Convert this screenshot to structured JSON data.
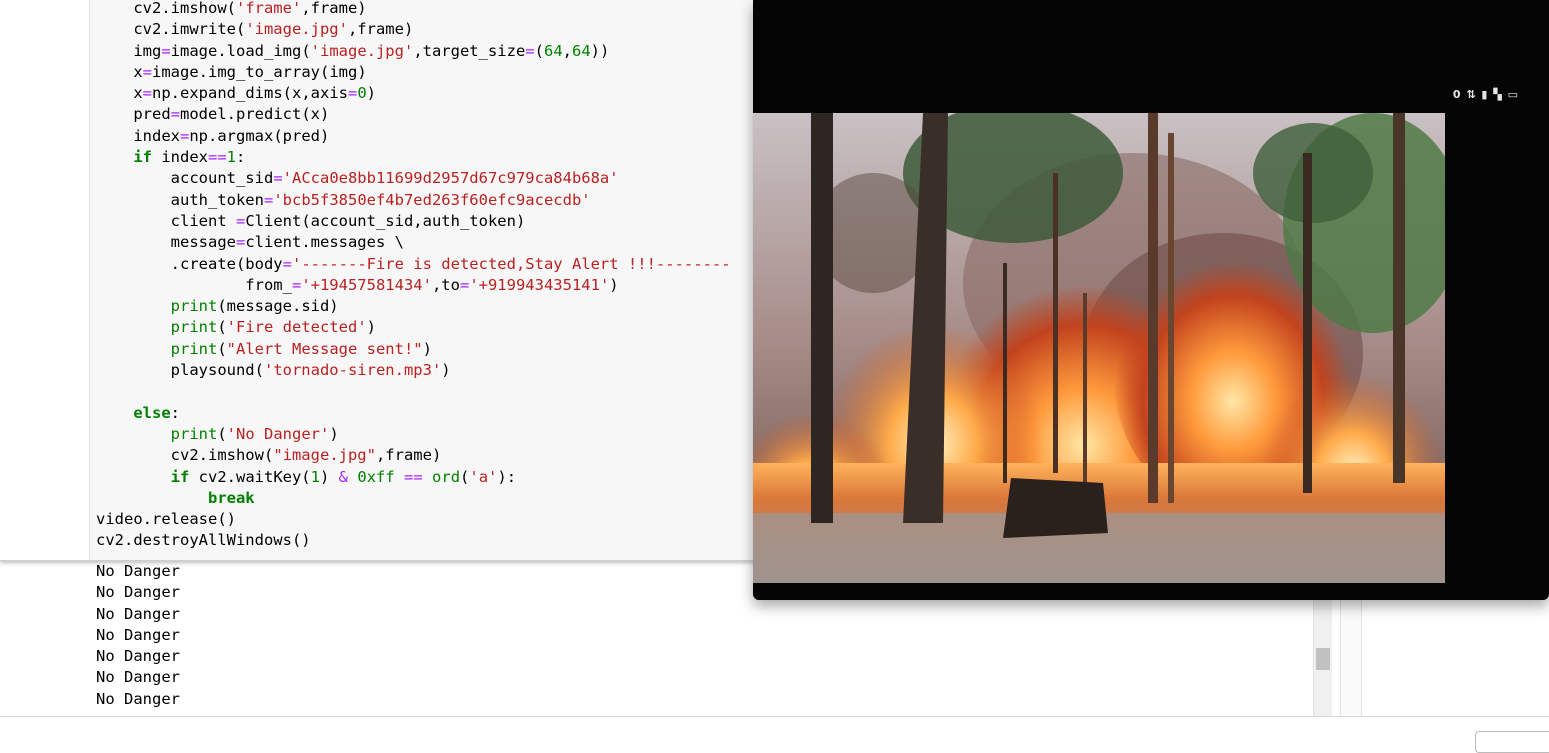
{
  "code_lines": [
    [
      {
        "t": "    cv2.imshow("
      },
      {
        "t": "'frame'",
        "c": "str"
      },
      {
        "t": ",frame)"
      }
    ],
    [
      {
        "t": "    cv2.imwrite("
      },
      {
        "t": "'image.jpg'",
        "c": "str"
      },
      {
        "t": ",frame)"
      }
    ],
    [
      {
        "t": "    img"
      },
      {
        "t": "=",
        "c": "op"
      },
      {
        "t": "image.load_img("
      },
      {
        "t": "'image.jpg'",
        "c": "str"
      },
      {
        "t": ",target_size"
      },
      {
        "t": "=",
        "c": "op"
      },
      {
        "t": "("
      },
      {
        "t": "64",
        "c": "num"
      },
      {
        "t": ","
      },
      {
        "t": "64",
        "c": "num"
      },
      {
        "t": "))"
      }
    ],
    [
      {
        "t": "    x"
      },
      {
        "t": "=",
        "c": "op"
      },
      {
        "t": "image.img_to_array(img)"
      }
    ],
    [
      {
        "t": "    x"
      },
      {
        "t": "=",
        "c": "op"
      },
      {
        "t": "np.expand_dims(x,axis"
      },
      {
        "t": "=",
        "c": "op"
      },
      {
        "t": "0",
        "c": "num"
      },
      {
        "t": ")"
      }
    ],
    [
      {
        "t": "    pred"
      },
      {
        "t": "=",
        "c": "op"
      },
      {
        "t": "model.predict(x)"
      }
    ],
    [
      {
        "t": "    index"
      },
      {
        "t": "=",
        "c": "op"
      },
      {
        "t": "np.argmax(pred)"
      }
    ],
    [
      {
        "t": "    "
      },
      {
        "t": "if",
        "c": "kw"
      },
      {
        "t": " index"
      },
      {
        "t": "==",
        "c": "op"
      },
      {
        "t": "1",
        "c": "num"
      },
      {
        "t": ":"
      }
    ],
    [
      {
        "t": "        account_sid"
      },
      {
        "t": "=",
        "c": "op"
      },
      {
        "t": "'ACca0e8bb11699d2957d67c979ca84b68a'",
        "c": "str"
      }
    ],
    [
      {
        "t": "        auth_token"
      },
      {
        "t": "=",
        "c": "op"
      },
      {
        "t": "'bcb5f3850ef4b7ed263f60efc9acecdb'",
        "c": "str"
      }
    ],
    [
      {
        "t": "        client "
      },
      {
        "t": "=",
        "c": "op"
      },
      {
        "t": "Client(account_sid,auth_token)"
      }
    ],
    [
      {
        "t": "        message"
      },
      {
        "t": "=",
        "c": "op"
      },
      {
        "t": "client.messages \\"
      }
    ],
    [
      {
        "t": "        .create(body"
      },
      {
        "t": "=",
        "c": "op"
      },
      {
        "t": "'-------Fire is detected,Stay Alert !!!--------",
        "c": "str"
      }
    ],
    [
      {
        "t": "                from_"
      },
      {
        "t": "=",
        "c": "op"
      },
      {
        "t": "'+19457581434'",
        "c": "str"
      },
      {
        "t": ",to"
      },
      {
        "t": "=",
        "c": "op"
      },
      {
        "t": "'+919943435141'",
        "c": "str"
      },
      {
        "t": ")"
      }
    ],
    [
      {
        "t": "        "
      },
      {
        "t": "print",
        "c": "fn"
      },
      {
        "t": "(message.sid)"
      }
    ],
    [
      {
        "t": "        "
      },
      {
        "t": "print",
        "c": "fn"
      },
      {
        "t": "("
      },
      {
        "t": "'Fire detected'",
        "c": "str"
      },
      {
        "t": ")"
      }
    ],
    [
      {
        "t": "        "
      },
      {
        "t": "print",
        "c": "fn"
      },
      {
        "t": "("
      },
      {
        "t": "\"Alert Message sent!\"",
        "c": "str"
      },
      {
        "t": ")"
      }
    ],
    [
      {
        "t": "        playsound("
      },
      {
        "t": "'tornado-siren.mp3'",
        "c": "str"
      },
      {
        "t": ")"
      }
    ],
    [
      {
        "t": ""
      }
    ],
    [
      {
        "t": "    "
      },
      {
        "t": "else",
        "c": "kw"
      },
      {
        "t": ":"
      }
    ],
    [
      {
        "t": "        "
      },
      {
        "t": "print",
        "c": "fn"
      },
      {
        "t": "("
      },
      {
        "t": "'No Danger'",
        "c": "str"
      },
      {
        "t": ")"
      }
    ],
    [
      {
        "t": "        cv2.imshow("
      },
      {
        "t": "\"image.jpg\"",
        "c": "str"
      },
      {
        "t": ",frame)"
      }
    ],
    [
      {
        "t": "        "
      },
      {
        "t": "if",
        "c": "kw"
      },
      {
        "t": " cv2.waitKey("
      },
      {
        "t": "1",
        "c": "num"
      },
      {
        "t": ") "
      },
      {
        "t": "&",
        "c": "op"
      },
      {
        "t": " "
      },
      {
        "t": "0xff",
        "c": "num"
      },
      {
        "t": " "
      },
      {
        "t": "==",
        "c": "op"
      },
      {
        "t": " "
      },
      {
        "t": "ord",
        "c": "fn"
      },
      {
        "t": "("
      },
      {
        "t": "'a'",
        "c": "str"
      },
      {
        "t": "):"
      }
    ],
    [
      {
        "t": "            "
      },
      {
        "t": "break",
        "c": "kw"
      }
    ],
    [
      {
        "t": "video.release()"
      }
    ],
    [
      {
        "t": "cv2.destroyAllWindows()"
      }
    ]
  ],
  "output_lines": [
    "No Danger",
    "No Danger",
    "No Danger",
    "No Danger",
    "No Danger",
    "No Danger",
    "No Danger"
  ],
  "video_window": {
    "status_icons_text": "0 ⇅ ▮ ▚ ▭",
    "frame_description_icon": "forest-fire-frame"
  }
}
